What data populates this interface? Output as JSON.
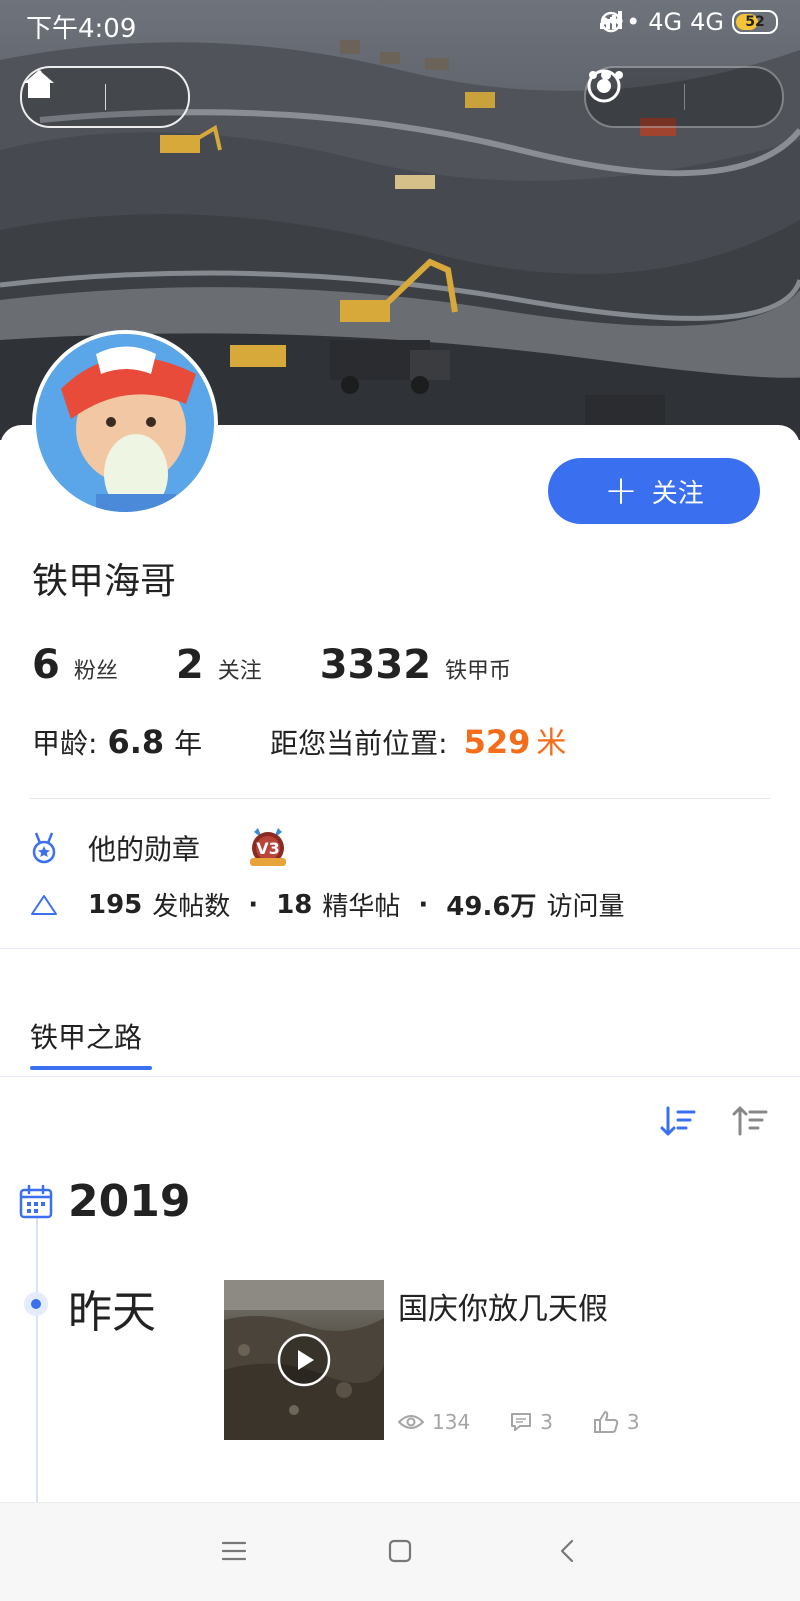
{
  "status_bar": {
    "time": "下午4:09",
    "signal_1": "4G",
    "signal_2": "4G",
    "battery": "52"
  },
  "profile": {
    "username": "铁甲海哥",
    "follow_button": "关注",
    "stats": [
      {
        "value": "6",
        "label": "粉丝"
      },
      {
        "value": "2",
        "label": "关注"
      },
      {
        "value": "3332",
        "label": "铁甲币"
      }
    ],
    "age_label": "甲龄:",
    "age_value": "6.8",
    "age_unit": "年",
    "distance_label": "距您当前位置:",
    "distance_value": "529",
    "distance_unit": "米"
  },
  "badges": {
    "label": "他的勋章",
    "badge_text": "V3"
  },
  "post_stats": {
    "posts_count": "195",
    "posts_label": "发帖数",
    "featured_count": "18",
    "featured_label": "精华帖",
    "visits_count": "49.6万",
    "visits_label": "访问量",
    "separator": "·"
  },
  "tabs": [
    {
      "label": "铁甲之路",
      "active": true
    }
  ],
  "timeline": {
    "year": "2019",
    "day": "昨天",
    "post": {
      "title": "国庆你放几天假",
      "views": "134",
      "comments": "3",
      "likes": "3"
    }
  },
  "colors": {
    "accent": "#3a6ff0",
    "distance": "#f36d1b",
    "meta": "#a5a5a5"
  }
}
